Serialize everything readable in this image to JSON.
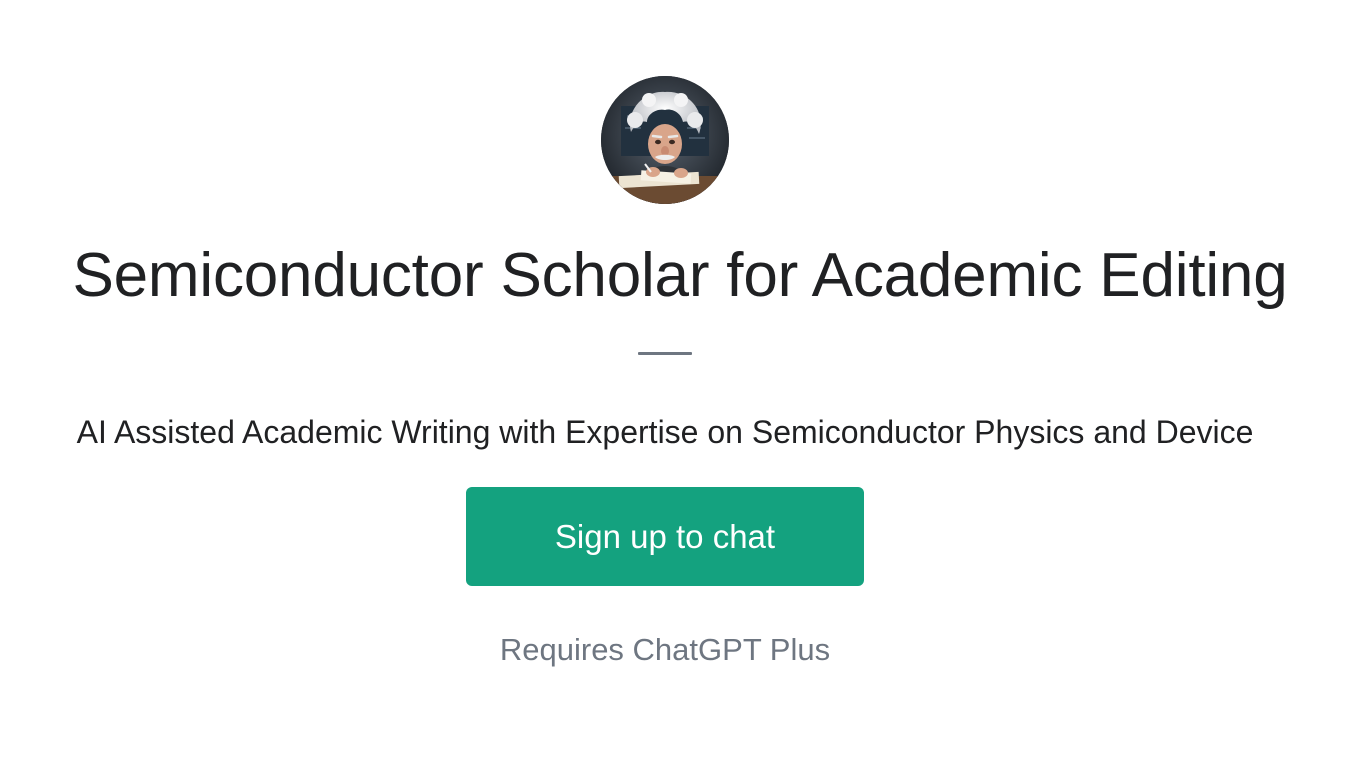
{
  "gpt": {
    "avatar_icon": "scholar-portrait-avatar",
    "title": "Semiconductor Scholar for Academic Editing",
    "description": "AI Assisted Academic Writing with Expertise on Semiconductor Physics and Device"
  },
  "actions": {
    "signup_label": "Sign up to chat",
    "requirement_text": "Requires ChatGPT Plus"
  },
  "colors": {
    "accent": "#14a27f",
    "title_text": "#202123",
    "muted_text": "#6e7681",
    "background": "#ffffff"
  }
}
